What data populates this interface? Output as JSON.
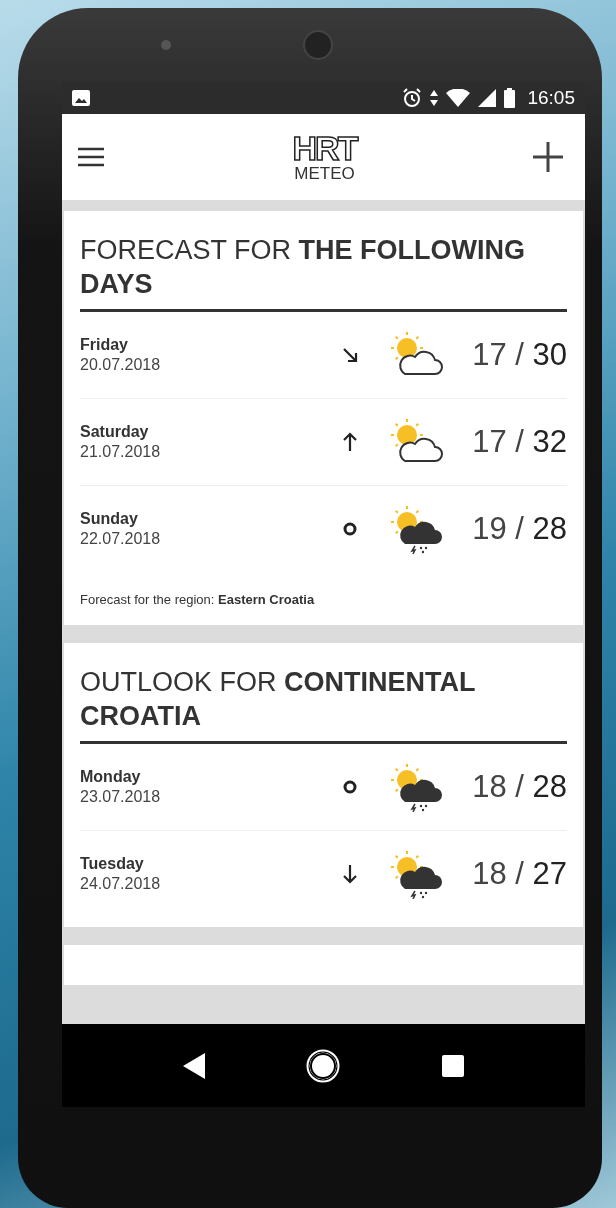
{
  "status_bar": {
    "time": "16:05"
  },
  "app_bar": {
    "logo_mark": "HRT",
    "logo_text": "METEO"
  },
  "cards": [
    {
      "title": "FORECAST FOR **THE FOLLOWING DAYS**",
      "days": [
        {
          "day": "Friday",
          "date": "20.07.2018",
          "trend": {
            "kind": "down-right"
          },
          "weather": {
            "kind": "partly-cloudy"
          },
          "temps": "17 / **30**"
        },
        {
          "day": "Saturday",
          "date": "21.07.2018",
          "trend": {
            "kind": "up"
          },
          "weather": {
            "kind": "partly-cloudy"
          },
          "temps": "17 / **32**"
        },
        {
          "day": "Sunday",
          "date": "22.07.2018",
          "trend": {
            "kind": "steady"
          },
          "weather": {
            "kind": "sun-storm"
          },
          "temps": "19 / **28**"
        }
      ],
      "footer": "Forecast for the region: **Eastern Croatia**"
    },
    {
      "title": "OUTLOOK FOR **CONTINENTAL CROATIA**",
      "days": [
        {
          "day": "Monday",
          "date": "23.07.2018",
          "trend": {
            "kind": "steady"
          },
          "weather": {
            "kind": "sun-storm"
          },
          "temps": "18 / **28**"
        },
        {
          "day": "Tuesday",
          "date": "24.07.2018",
          "trend": {
            "kind": "down"
          },
          "weather": {
            "kind": "sun-storm"
          },
          "temps": "18 / **27**"
        }
      ]
    }
  ]
}
